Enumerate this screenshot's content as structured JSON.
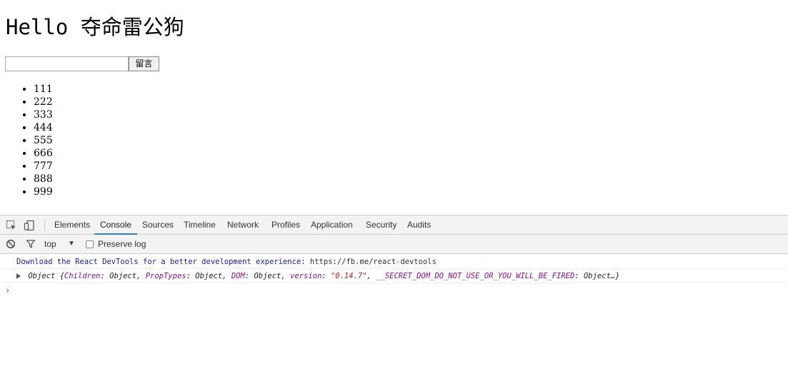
{
  "page": {
    "title": "Hello 夺命雷公狗",
    "input_value": "",
    "button_label": "留言",
    "messages": [
      "111",
      "222",
      "333",
      "444",
      "555",
      "666",
      "777",
      "888",
      "999"
    ]
  },
  "devtools": {
    "tabs": [
      "Elements",
      "Console",
      "Sources",
      "Timeline",
      "Network",
      "Profiles",
      "Application",
      "Security",
      "Audits"
    ],
    "active_tab": "Console",
    "toolbar": {
      "context": "top",
      "preserve_log_label": "Preserve log",
      "preserve_log_checked": false
    },
    "console": {
      "line1_text": "Download the React DevTools for a better development experience: ",
      "line1_link": "https://fb.me/react-devtools",
      "line2": {
        "prefix": "Object {",
        "k1": "Children",
        "v1": ": Object, ",
        "k2": "PropTypes",
        "v2": ": Object, ",
        "k3": "DOM",
        "v3": ": Object, ",
        "k4": "version",
        "sep4": ": ",
        "s4": "\"0.14.7\"",
        "comma4": ", ",
        "k5": "__SECRET_DOM_DO_NOT_USE_OR_YOU_WILL_BE_FIRED",
        "v5": ": Object…}"
      },
      "prompt": "›"
    },
    "colors": {
      "accent": "#3879d9",
      "info_text": "#1a1aa6",
      "key": "#881391",
      "string": "#c41a16"
    }
  }
}
